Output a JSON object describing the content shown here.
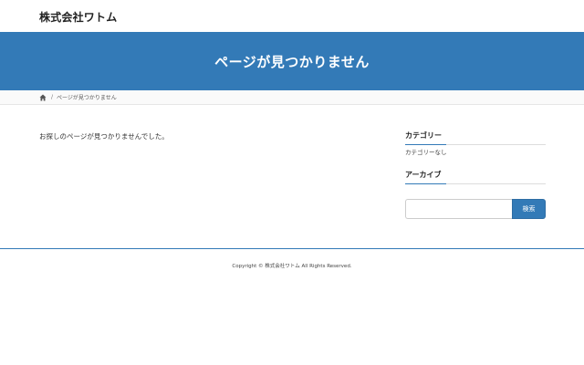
{
  "header": {
    "site_title": "株式会社ワトム"
  },
  "page_header": {
    "title": "ページが見つかりません"
  },
  "breadcrumb": {
    "home_icon": "home-icon",
    "separator": "/",
    "current": "ページが見つかりません"
  },
  "main": {
    "message": "お探しのページが見つかりませんでした。"
  },
  "sidebar": {
    "category": {
      "title": "カテゴリー",
      "empty_text": "カテゴリーなし"
    },
    "archive": {
      "title": "アーカイブ"
    },
    "search": {
      "placeholder": "",
      "value": "",
      "button_label": "検索"
    }
  },
  "footer": {
    "copyright": "Copyright © 株式会社ワトム All Rights Reserved."
  },
  "colors": {
    "accent": "#337ab7",
    "header_text": "#ffffff"
  }
}
